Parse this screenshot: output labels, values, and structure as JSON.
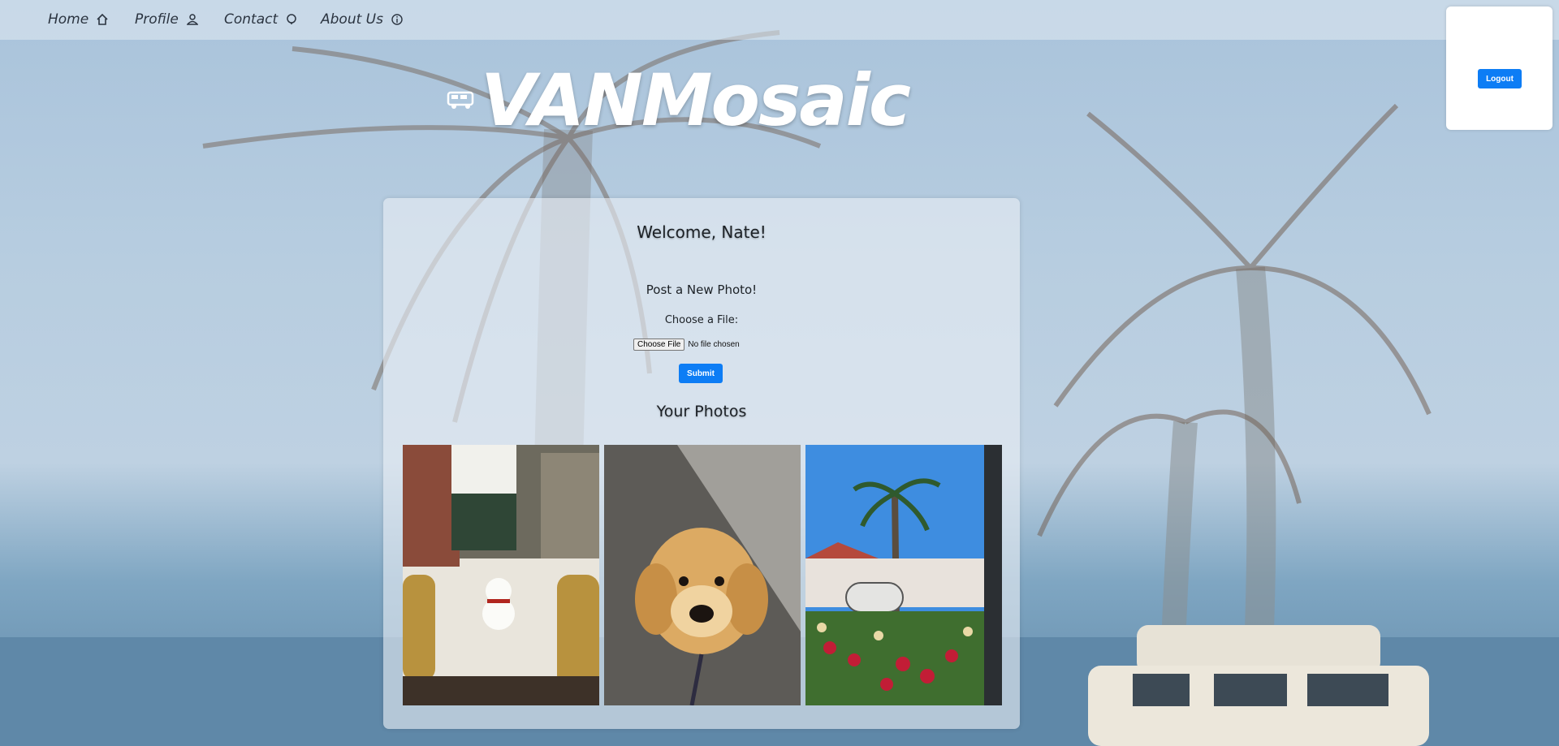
{
  "nav": {
    "items": [
      {
        "label": "Home",
        "icon": "home-icon"
      },
      {
        "label": "Profile",
        "icon": "person-icon"
      },
      {
        "label": "Contact",
        "icon": "chat-icon"
      },
      {
        "label": "About Us",
        "icon": "info-icon"
      }
    ]
  },
  "header": {
    "brand_title": "VANMosaic",
    "brand_icon": "van-icon"
  },
  "account": {
    "logout_label": "Logout"
  },
  "main": {
    "welcome": "Welcome, Nate!",
    "post_title": "Post a New Photo!",
    "choose_label": "Choose a File:",
    "file_button": "Choose File",
    "file_status": "No file chosen",
    "submit_label": "Submit",
    "photos_title": "Your Photos",
    "photos": [
      {
        "subject": "snowman-village-photo"
      },
      {
        "subject": "golden-retriever-puppy-photo"
      },
      {
        "subject": "coronado-sign-palm-photo"
      }
    ]
  },
  "colors": {
    "accent": "#0d7df5",
    "sky": "#bed1e2",
    "card": "#e8eef4"
  }
}
